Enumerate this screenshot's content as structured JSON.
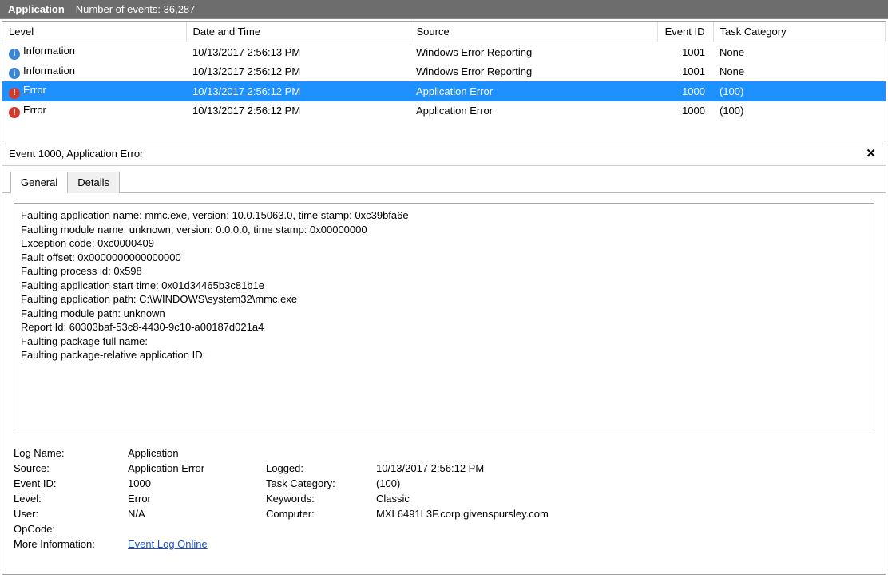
{
  "header": {
    "title": "Application",
    "events_label": "Number of events:",
    "events_count": "36,287"
  },
  "columns": {
    "level": "Level",
    "date": "Date and Time",
    "source": "Source",
    "event_id": "Event ID",
    "task": "Task Category"
  },
  "events": [
    {
      "icon": "info",
      "level": "Information",
      "date": "10/13/2017 2:56:13 PM",
      "source": "Windows Error Reporting",
      "event_id": "1001",
      "task": "None",
      "selected": false
    },
    {
      "icon": "info",
      "level": "Information",
      "date": "10/13/2017 2:56:12 PM",
      "source": "Windows Error Reporting",
      "event_id": "1001",
      "task": "None",
      "selected": false
    },
    {
      "icon": "error",
      "level": "Error",
      "date": "10/13/2017 2:56:12 PM",
      "source": "Application Error",
      "event_id": "1000",
      "task": "(100)",
      "selected": true
    },
    {
      "icon": "error",
      "level": "Error",
      "date": "10/13/2017 2:56:12 PM",
      "source": "Application Error",
      "event_id": "1000",
      "task": "(100)",
      "selected": false
    }
  ],
  "detail": {
    "header": "Event 1000, Application Error",
    "tabs": {
      "general": "General",
      "details": "Details"
    },
    "message": "Faulting application name: mmc.exe, version: 10.0.15063.0, time stamp: 0xc39bfa6e\nFaulting module name: unknown, version: 0.0.0.0, time stamp: 0x00000000\nException code: 0xc0000409\nFault offset: 0x0000000000000000\nFaulting process id: 0x598\nFaulting application start time: 0x01d34465b3c81b1e\nFaulting application path: C:\\WINDOWS\\system32\\mmc.exe\nFaulting module path: unknown\nReport Id: 60303baf-53c8-4430-9c10-a00187d021a4\nFaulting package full name:\nFaulting package-relative application ID:",
    "labels": {
      "log_name": "Log Name:",
      "source": "Source:",
      "event_id": "Event ID:",
      "level": "Level:",
      "user": "User:",
      "opcode": "OpCode:",
      "more_info": "More Information:",
      "logged": "Logged:",
      "task_category": "Task Category:",
      "keywords": "Keywords:",
      "computer": "Computer:"
    },
    "values": {
      "log_name": "Application",
      "source": "Application Error",
      "event_id": "1000",
      "level": "Error",
      "user": "N/A",
      "opcode": "",
      "more_info_link": "Event Log Online ",
      "logged": "10/13/2017 2:56:12 PM",
      "task_category": "(100)",
      "keywords": "Classic",
      "computer": "MXL6491L3F.corp.givenspursley.com"
    }
  }
}
